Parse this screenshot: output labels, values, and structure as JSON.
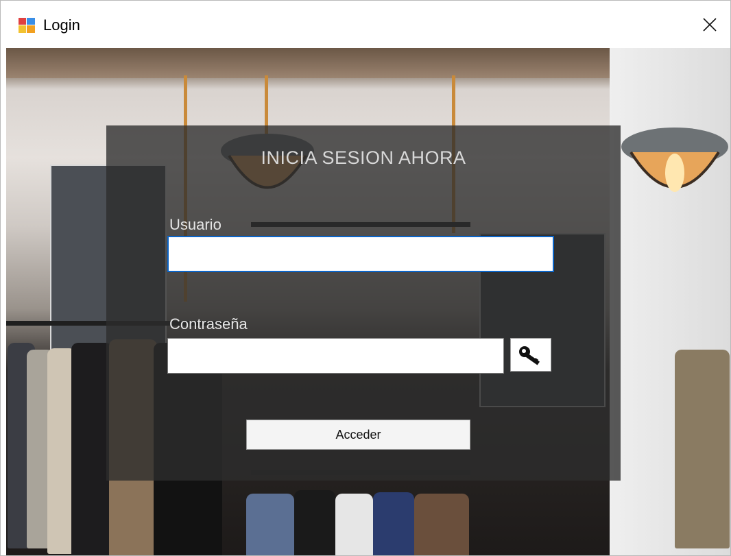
{
  "window": {
    "title": "Login",
    "close_glyph": "✕"
  },
  "form": {
    "heading": "INICIA SESION AHORA",
    "user_label": "Usuario",
    "user_value": "",
    "password_label": "Contraseña",
    "password_value": "",
    "show_password_icon": "key-icon",
    "submit_label": "Acceder"
  },
  "colors": {
    "focus_border": "#0a64c8",
    "panel_overlay": "#2d2d2d"
  }
}
